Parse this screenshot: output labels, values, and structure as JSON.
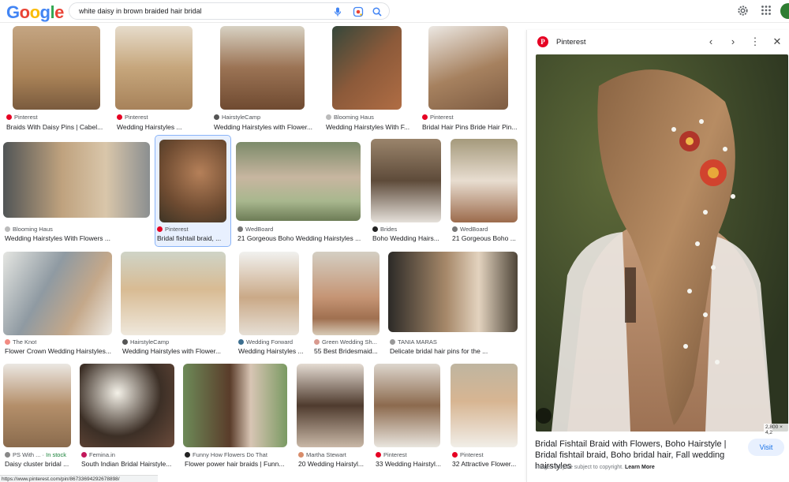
{
  "header": {
    "logo": {
      "G": "G",
      "o1": "o",
      "o2": "o",
      "g": "g",
      "l": "l",
      "e": "e"
    },
    "search_query": "white daisy in brown braided hair bridal"
  },
  "results": {
    "row1": [
      {
        "source": "Pinterest",
        "title": "Braids With Daisy Pins | Cabel...",
        "fav": "#e60023"
      },
      {
        "source": "Pinterest",
        "title": "Wedding Hairstyles ...",
        "fav": "#e60023"
      },
      {
        "source": "HairstyleCamp",
        "title": "Wedding Hairstyles with Flower...",
        "fav": "#555555"
      },
      {
        "source": "Blooming Haus",
        "title": "Wedding Hairstyles With F...",
        "fav": "#bbbbbb"
      },
      {
        "source": "Pinterest",
        "title": "Bridal Hair Pins Bride Hair Pin...",
        "fav": "#e60023"
      }
    ],
    "row2": [
      {
        "source": "Blooming Haus",
        "title": "Wedding Hairstyles With Flowers ...",
        "fav": "#bbbbbb"
      },
      {
        "source": "Pinterest",
        "title": "Bridal fishtail braid, ...",
        "fav": "#e60023"
      },
      {
        "source": "WedBoard",
        "title": "21 Gorgeous Boho Wedding Hairstyles ...",
        "fav": "#777777"
      },
      {
        "source": "Brides",
        "title": "Boho Wedding Hairs...",
        "fav": "#222222"
      },
      {
        "source": "WedBoard",
        "title": "21 Gorgeous Boho ...",
        "fav": "#777777"
      }
    ],
    "row3": [
      {
        "source": "The Knot",
        "title": "Flower Crown Wedding Hairstyles...",
        "fav": "#f28b82"
      },
      {
        "source": "HairstyleCamp",
        "title": "Wedding Hairstyles with Flower...",
        "fav": "#555555"
      },
      {
        "source": "Wedding Forward",
        "title": "Wedding Hairstyles ...",
        "fav": "#3c6e8f"
      },
      {
        "source": "Green Wedding Sh...",
        "title": "55 Best Bridesmaid...",
        "fav": "#d99a8f"
      },
      {
        "source": "TANIA MARAS",
        "title": "Delicate bridal hair pins for the ...",
        "fav": "#999999"
      }
    ],
    "row4": [
      {
        "source": "PS With ...",
        "stock": "In stock",
        "title": "Daisy cluster bridal ...",
        "fav": "#888888"
      },
      {
        "source": "Femina.in",
        "title": "South Indian Bridal Hairstyle...",
        "fav": "#c2185b"
      },
      {
        "source": "Funny How Flowers Do That",
        "title": "Flower power hair braids | Funn...",
        "fav": "#222222"
      },
      {
        "source": "Martha Stewart",
        "title": "20 Wedding Hairstyl...",
        "fav": "#d88c6a"
      },
      {
        "source": "Pinterest",
        "title": "33 Wedding Hairstyl...",
        "fav": "#e60023"
      },
      {
        "source": "Pinterest",
        "title": "32 Attractive Flower...",
        "fav": "#e60023"
      }
    ]
  },
  "panel": {
    "site": "Pinterest",
    "fav_letter": "P",
    "dimensions": "2,800 × 4,2",
    "title": "Bridal Fishtail Braid with Flowers, Boho Hairstyle | Bridal fishtail braid, Boho bridal hair, Fall wedding hairstyles",
    "visit": "Visit",
    "copyright": "Images may be subject to copyright.",
    "learn_more": "Learn More"
  },
  "status_url": "https://www.pinterest.com/pin/86733694292678898/"
}
